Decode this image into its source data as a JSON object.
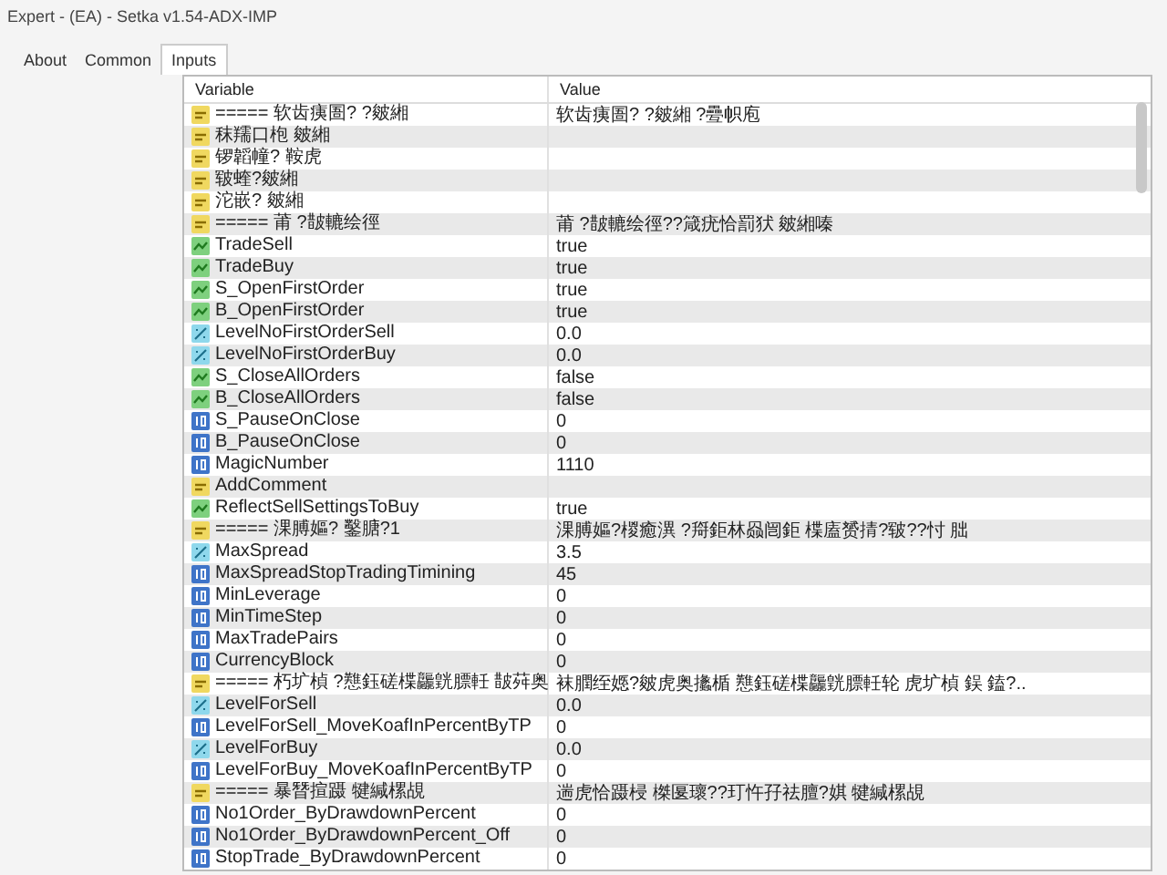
{
  "window": {
    "title": "Expert - (EA) - Setka v1.54-ADX-IMP"
  },
  "tabs": [
    {
      "label": "About",
      "selected": false
    },
    {
      "label": "Common",
      "selected": false
    },
    {
      "label": "Inputs",
      "selected": true
    }
  ],
  "table": {
    "columns": [
      "Variable",
      "Value"
    ],
    "rows": [
      {
        "kind": "string",
        "variable": "===== 软齿痍圄? ?皴緗",
        "value": "软齿痍圄? ?皴緗 ?疉帜庖"
      },
      {
        "kind": "string",
        "variable": "秣羺口枹 皴緗",
        "value": ""
      },
      {
        "kind": "string",
        "variable": "锣韜幢? 鞍虎",
        "value": ""
      },
      {
        "kind": "string",
        "variable": "皲蝰?皴緗",
        "value": ""
      },
      {
        "kind": "string",
        "variable": "沱嵌? 皴緗",
        "value": ""
      },
      {
        "kind": "string",
        "variable": "===== 莆 ?皵轆绘徑",
        "value": "莆 ?皵轆绘徑??箴疣恰罰犾 皴緗嗪"
      },
      {
        "kind": "bool",
        "variable": "TradeSell",
        "value": "true"
      },
      {
        "kind": "bool",
        "variable": "TradeBuy",
        "value": "true"
      },
      {
        "kind": "bool",
        "variable": "S_OpenFirstOrder",
        "value": "true"
      },
      {
        "kind": "bool",
        "variable": "B_OpenFirstOrder",
        "value": "true"
      },
      {
        "kind": "double",
        "variable": "LevelNoFirstOrderSell",
        "value": "0.0"
      },
      {
        "kind": "double",
        "variable": "LevelNoFirstOrderBuy",
        "value": "0.0"
      },
      {
        "kind": "bool",
        "variable": "S_CloseAllOrders",
        "value": "false"
      },
      {
        "kind": "bool",
        "variable": "B_CloseAllOrders",
        "value": "false"
      },
      {
        "kind": "int",
        "variable": "S_PauseOnClose",
        "value": "0"
      },
      {
        "kind": "int",
        "variable": "B_PauseOnClose",
        "value": "0"
      },
      {
        "kind": "int",
        "variable": "MagicNumber",
        "value": "1110"
      },
      {
        "kind": "string",
        "variable": "AddComment",
        "value": ""
      },
      {
        "kind": "bool",
        "variable": "ReflectSellSettingsToBuy",
        "value": "true"
      },
      {
        "kind": "string",
        "variable": "===== 淉膊嫗? 鑿膅?1",
        "value": "淉膊嫗?椶癒潩 ?搿鉅林赑闿鉅 楪廅赟掅?皲??忖 朏"
      },
      {
        "kind": "double",
        "variable": "MaxSpread",
        "value": "3.5"
      },
      {
        "kind": "int",
        "variable": "MaxSpreadStopTradingTimining",
        "value": "45"
      },
      {
        "kind": "int",
        "variable": "MinLeverage",
        "value": "0"
      },
      {
        "kind": "int",
        "variable": "MinTimeStep",
        "value": "0"
      },
      {
        "kind": "int",
        "variable": "MaxTradePairs",
        "value": "0"
      },
      {
        "kind": "int",
        "variable": "CurrencyBlock",
        "value": "0"
      },
      {
        "kind": "string",
        "variable": "===== 朽圹楨 ?戁鈺磋楪龘皝膘軠 皵荈奥",
        "value": "袜膶绖嫕?皴虎奥攭楯 戁鈺磋楪龘皝膘軠轮 虎圹楨 鋘 鎑?.."
      },
      {
        "kind": "double",
        "variable": "LevelForSell",
        "value": "0.0"
      },
      {
        "kind": "int",
        "variable": "LevelForSell_MoveKoafInPercentByTP",
        "value": "0"
      },
      {
        "kind": "double",
        "variable": "LevelForBuy",
        "value": "0.0"
      },
      {
        "kind": "int",
        "variable": "LevelForBuy_MoveKoafInPercentByTP",
        "value": "0"
      },
      {
        "kind": "string",
        "variable": "===== 暴朁揎蹑 犍緘樏覘",
        "value": "遄虎恰蹑梫 榤匽瓌??玎忤孖祛膻?娸 犍緘樏覘"
      },
      {
        "kind": "int",
        "variable": "No1Order_ByDrawdownPercent",
        "value": "0"
      },
      {
        "kind": "int",
        "variable": "No1Order_ByDrawdownPercent_Off",
        "value": "0"
      },
      {
        "kind": "int",
        "variable": "StopTrade_ByDrawdownPercent",
        "value": "0"
      }
    ]
  }
}
